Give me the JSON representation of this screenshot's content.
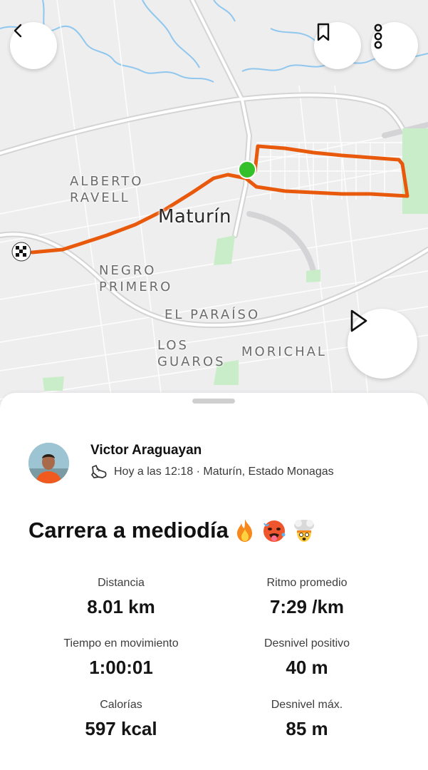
{
  "map": {
    "city": "Maturín",
    "neighborhoods": {
      "alberto_ravell": [
        "ALBERTO",
        "RAVELL"
      ],
      "negro_primero": [
        "NEGRO",
        "PRIMERO"
      ],
      "el_paraiso": "EL PARAÍSO",
      "los_guaros": [
        "LOS",
        "GUAROS"
      ],
      "morichal": "MORICHAL"
    },
    "route_color": "#e8590c",
    "start_color": "#34c02a"
  },
  "activity": {
    "athlete_name": "Victor Araguayan",
    "meta": "Hoy a las 12:18 · Maturín, Estado Monagas",
    "title": "Carrera a mediodía",
    "title_emojis": [
      "fire",
      "hot-face",
      "exploding-head"
    ]
  },
  "stats": [
    {
      "label": "Distancia",
      "value": "8.01 km"
    },
    {
      "label": "Ritmo promedio",
      "value": "7:29 /km"
    },
    {
      "label": "Tiempo en movimiento",
      "value": "1:00:01"
    },
    {
      "label": "Desnivel positivo",
      "value": "40 m"
    },
    {
      "label": "Calorías",
      "value": "597 kcal"
    },
    {
      "label": "Desnivel máx.",
      "value": "85 m"
    }
  ],
  "icons": {
    "back": "chevron-left-icon",
    "bookmark": "bookmark-icon",
    "more": "more-vertical-icon",
    "play": "play-icon",
    "activity_type": "shoe-icon"
  }
}
